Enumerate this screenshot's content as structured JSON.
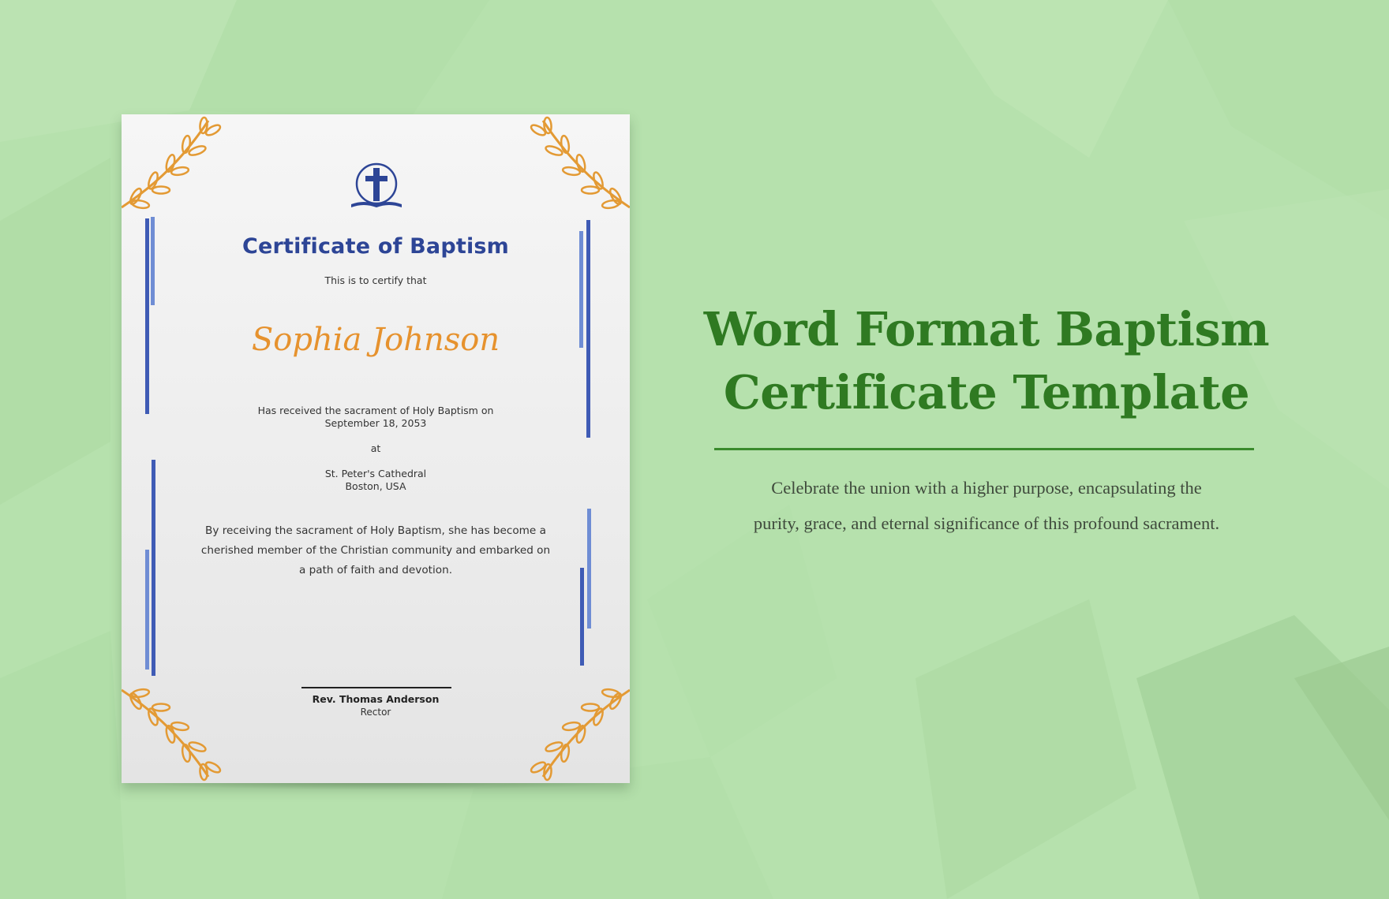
{
  "background": {
    "color": "#b6e1ad"
  },
  "certificate": {
    "logo_icon": "cross-book-icon",
    "title": "Certificate of Baptism",
    "intro": "This is to certify that",
    "recipient_name": "Sophia Johnson",
    "received_line_1": "Has received the sacrament of Holy Baptism on",
    "date": "September 18, 2053",
    "at_label": "at",
    "church": "St. Peter's Cathedral",
    "location": "Boston, USA",
    "body_text": "By receiving the sacrament of Holy Baptism, she has become a cherished member of the Christian community and embarked on a path of faith and devotion.",
    "signatory_name": "Rev. Thomas Anderson",
    "signatory_role": "Rector",
    "colors": {
      "title": "#2d4596",
      "name": "#e6922e",
      "bars": "#3f5bb5",
      "laurel": "#e39a34"
    }
  },
  "promo": {
    "headline_line_1": "Word Format Baptism",
    "headline_line_2": "Certificate Template",
    "tagline_line_1": "Celebrate the union with a higher purpose, encapsulating the",
    "tagline_line_2": "purity, grace, and eternal significance of this profound sacrament.",
    "colors": {
      "headline": "#2f7a22",
      "divider": "#3a8a2c"
    }
  }
}
